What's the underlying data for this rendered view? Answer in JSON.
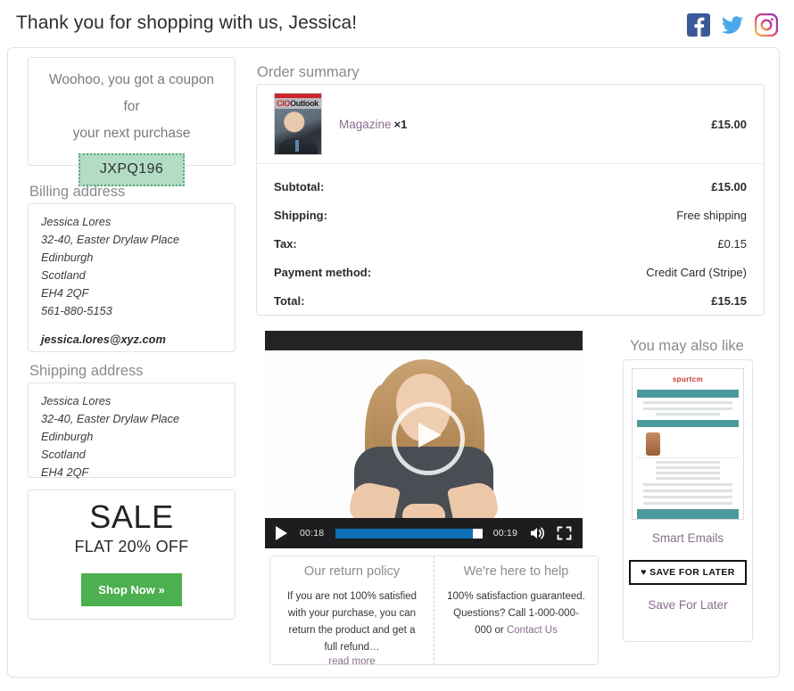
{
  "header": {
    "title": "Thank you for shopping with us, Jessica!",
    "socials": [
      {
        "name": "facebook-icon",
        "label": "Facebook"
      },
      {
        "name": "twitter-icon",
        "label": "Twitter"
      },
      {
        "name": "instagram-icon",
        "label": "Instagram"
      }
    ]
  },
  "coupon": {
    "line1": "Woohoo, you got a coupon for",
    "line2": "your next purchase",
    "code": "JXPQ196",
    "bg_color": "#b3dcc4",
    "border_color": "#5aa87c"
  },
  "billing": {
    "title": "Billing address",
    "lines": [
      "Jessica Lores",
      "32-40, Easter Drylaw Place",
      "Edinburgh",
      "Scotland",
      "EH4 2QF",
      "561-880-5153"
    ],
    "email": "jessica.lores@xyz.com"
  },
  "shipping": {
    "title": "Shipping address",
    "lines": [
      "Jessica Lores",
      "32-40, Easter Drylaw Place",
      "Edinburgh",
      "Scotland",
      "EH4 2QF"
    ]
  },
  "sale": {
    "headline": "SALE",
    "subline": "FLAT 20% OFF",
    "button": "Shop Now »",
    "button_color": "#4caf50"
  },
  "order_summary": {
    "title": "Order summary",
    "item": {
      "name": "Magazine",
      "qty": "×1",
      "price": "£15.00",
      "thumb_masthead_a": "CIO",
      "thumb_masthead_b": "Outlook"
    },
    "rows": [
      {
        "label": "Subtotal:",
        "value": "£15.00",
        "bold": true
      },
      {
        "label": "Shipping:",
        "value": "Free shipping",
        "bold": false
      },
      {
        "label": "Tax:",
        "value": "£0.15",
        "bold": false
      },
      {
        "label": "Payment method:",
        "value": "Credit Card (Stripe)",
        "bold": false
      },
      {
        "label": "Total:",
        "value": "£15.15",
        "bold": true
      }
    ]
  },
  "video": {
    "current_time": "00:18",
    "duration": "00:19",
    "progress_percent": 94,
    "progress_color": "#0f6fb5"
  },
  "policies": [
    {
      "heading": "Our return policy",
      "body": "If you are not 100% satisfied with your purchase, you can return the product and get a full refund…",
      "link": "read more"
    },
    {
      "heading": "We're here to help",
      "body": "100% satisfaction guaranteed. Questions? Call 1-000-000-000 or ",
      "link": "Contact Us"
    }
  ],
  "you_may_also_like": {
    "title": "You may also like",
    "product_name": "Smart Emails",
    "save_button": "SAVE FOR LATER",
    "save_link": "Save For Later"
  }
}
